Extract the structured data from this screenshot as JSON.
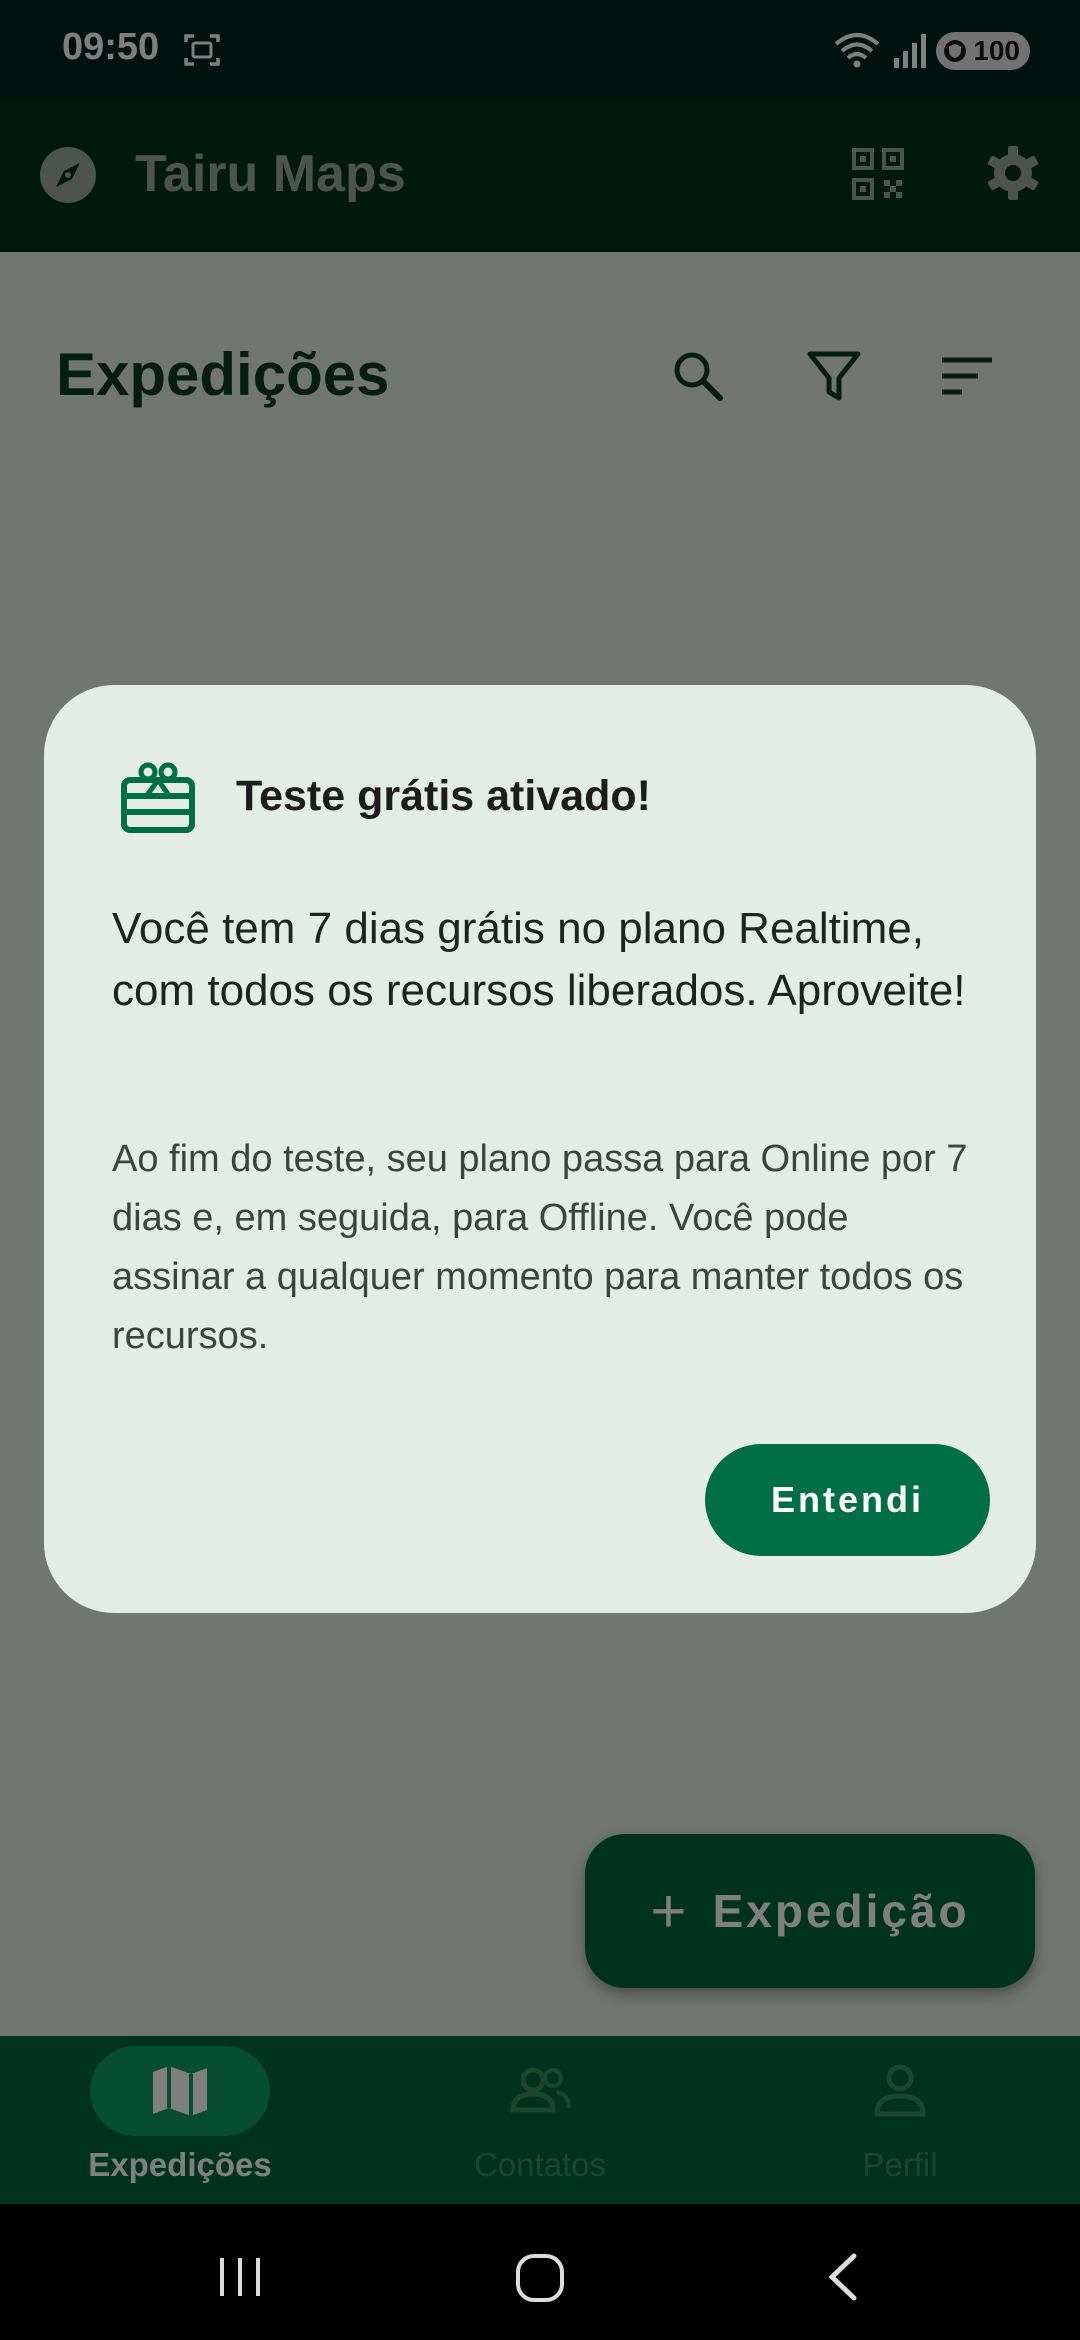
{
  "status_bar": {
    "time": "09:50",
    "battery": "100",
    "icons": [
      "screenshot-icon",
      "wifi-icon",
      "signal-icon",
      "shield-icon"
    ]
  },
  "app_bar": {
    "title": "Tairu Maps",
    "icons": [
      "compass-icon",
      "qr-code-icon",
      "settings-icon"
    ]
  },
  "page": {
    "title": "Expedições",
    "actions": [
      "search-icon",
      "filter-icon",
      "sort-icon"
    ]
  },
  "fab": {
    "label": "Expedição",
    "icon": "plus-icon"
  },
  "bottom_nav": {
    "items": [
      {
        "label": "Expedições",
        "icon": "map-icon",
        "selected": true
      },
      {
        "label": "Contatos",
        "icon": "people-icon",
        "selected": false
      },
      {
        "label": "Perfil",
        "icon": "person-icon",
        "selected": false
      }
    ]
  },
  "dialog": {
    "icon": "gift-icon",
    "title": "Teste grátis ativado!",
    "message": "Você tem 7 dias grátis no plano Realtime, com todos os recursos liberados. Aproveite!",
    "note": "Ao fim do teste, seu plano passa para Online por 7 dias e, em seguida, para Offline. Você pode assinar a qualquer momento para manter todos os recursos.",
    "button": "Entendi"
  },
  "system_nav": [
    "recents-button",
    "home-button",
    "back-button"
  ],
  "colors": {
    "primary": "#00663f",
    "dark_bar": "#00331f",
    "surface": "#e3ece5",
    "scrim": "rgba(0,0,0,0.5)"
  }
}
